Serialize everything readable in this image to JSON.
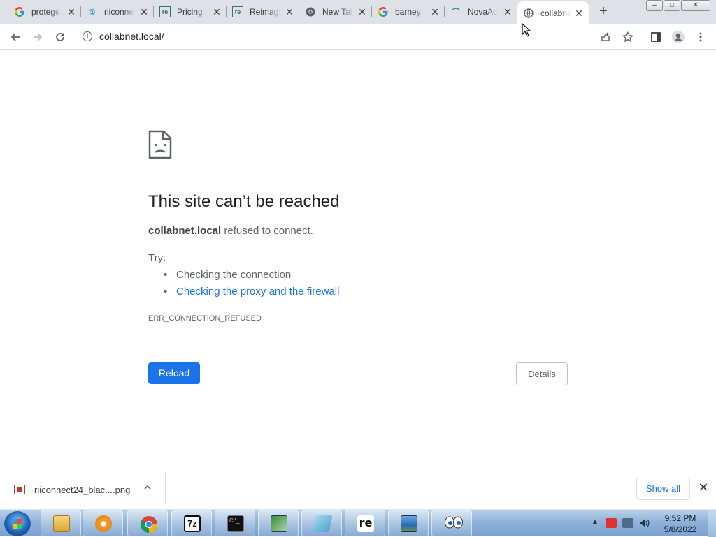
{
  "browser": {
    "tabs": [
      {
        "title": "protege",
        "favicon": "google-g-icon",
        "active": false
      },
      {
        "title": "riiconnect",
        "favicon": "riiconnect-icon",
        "active": false
      },
      {
        "title": "Pricing",
        "favicon": "re-icon",
        "active": false
      },
      {
        "title": "Reimagine",
        "favicon": "re-icon",
        "active": false
      },
      {
        "title": "New Tab",
        "favicon": "chrome-icon",
        "active": false
      },
      {
        "title": "barney",
        "favicon": "google-g-icon",
        "active": false
      },
      {
        "title": "NovaAc",
        "favicon": "nova-icon",
        "active": false
      },
      {
        "title": "collabnet",
        "favicon": "globe-icon",
        "active": true
      }
    ],
    "new_tab": "+",
    "window_buttons": {
      "minimize": "–",
      "maximize": "□",
      "close": "✕"
    },
    "address": "collabnet.local/",
    "toolbar_icons": [
      "back-icon",
      "forward-icon",
      "reload-icon",
      "site-info-icon",
      "share-icon",
      "bookmark-star-icon",
      "side-panel-icon",
      "profile-icon",
      "menu-icon"
    ]
  },
  "error_page": {
    "title": "This site can’t be reached",
    "host": "collabnet.local",
    "desc_rest": " refused to connect.",
    "try_label": "Try:",
    "suggestions": [
      "Checking the connection",
      "Checking the proxy and the firewall"
    ],
    "error_code": "ERR_CONNECTION_REFUSED",
    "reload_label": "Reload",
    "details_label": "Details"
  },
  "downloads": {
    "file_name": "riiconnect24_blac....png",
    "show_all_label": "Show all"
  },
  "taskbar": {
    "apps": [
      "explorer-icon",
      "media-player-icon",
      "chrome-icon",
      "7zip-icon",
      "cmd-icon",
      "network-tool-icon",
      "notepad-icon",
      "re-icon",
      "photo-icon",
      "eyes-icon"
    ],
    "time": "9:52 PM",
    "date": "5/8/2022"
  },
  "colors": {
    "accent": "#1a73e8",
    "tab_strip": "#dee1e6",
    "text_primary": "#202124",
    "text_secondary": "#5f6368"
  }
}
